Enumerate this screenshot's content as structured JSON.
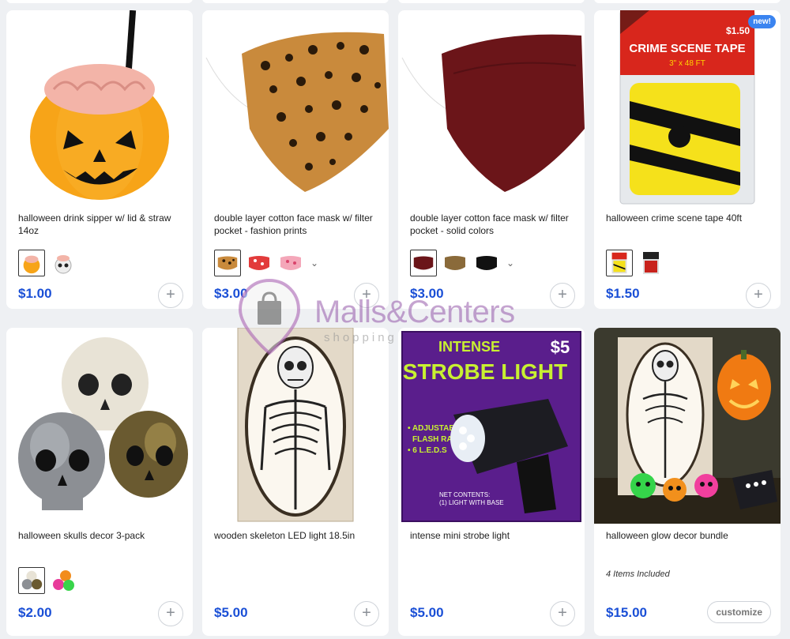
{
  "products": [
    {
      "name": "halloween drink sipper w/ lid & straw 14oz",
      "price": "$1.00",
      "image_icon": "pumpkin-sipper-icon",
      "swatches": [
        "pumpkin-sipper-swatch",
        "skull-sipper-swatch"
      ],
      "more_swatches": false,
      "action": "add"
    },
    {
      "name": "double layer cotton face mask w/ filter pocket - fashion prints",
      "price": "$3.00",
      "image_icon": "leopard-mask-icon",
      "swatches": [
        "leopard-swatch",
        "red-print-swatch",
        "pink-print-swatch"
      ],
      "more_swatches": true,
      "action": "add"
    },
    {
      "name": "double layer cotton face mask w/ filter pocket - solid colors",
      "price": "$3.00",
      "image_icon": "maroon-mask-icon",
      "swatches": [
        "maroon-swatch",
        "tan-swatch",
        "black-swatch"
      ],
      "more_swatches": true,
      "action": "add"
    },
    {
      "name": "halloween crime scene tape 40ft",
      "price": "$1.50",
      "badge": "new!",
      "image_icon": "crime-scene-tape-icon",
      "swatches": [
        "yellow-tape-swatch",
        "red-tape-swatch"
      ],
      "more_swatches": false,
      "action": "add"
    },
    {
      "name": "halloween skulls decor 3-pack",
      "price": "$2.00",
      "image_icon": "skulls-icon",
      "swatches": [
        "metal-skulls-swatch",
        "neon-skulls-swatch"
      ],
      "more_swatches": false,
      "action": "add"
    },
    {
      "name": "wooden skeleton LED light 18.5in",
      "price": "$5.00",
      "image_icon": "skeleton-frame-icon",
      "swatches": [],
      "more_swatches": false,
      "action": "add"
    },
    {
      "name": "intense mini strobe light",
      "price": "$5.00",
      "image_icon": "strobe-light-icon",
      "swatches": [],
      "more_swatches": false,
      "action": "add"
    },
    {
      "name": "halloween glow decor bundle",
      "price": "$15.00",
      "included": "4 Items Included",
      "image_icon": "glow-bundle-icon",
      "swatches": [],
      "more_swatches": false,
      "action": "customize",
      "action_label": "customize"
    }
  ],
  "package_text": {
    "tape_title": "CRIME SCENE TAPE",
    "tape_size": "3\" x 48 FT",
    "tape_price": "$1.50",
    "strobe_line1": "INTENSE",
    "strobe_line2": "STROBE LIGHT",
    "strobe_price": "$5",
    "strobe_feature1": "• ADJUSTABLE",
    "strobe_feature2": "FLASH RATE",
    "strobe_feature3": "• 6 L.E.D.S",
    "strobe_contents": "NET CONTENTS:",
    "strobe_contents2": "(1) LIGHT WITH BASE"
  },
  "watermark": {
    "brand": "Malls&Centers",
    "sub": "shopping"
  },
  "colors": {
    "price": "#1a4fd6",
    "badge": "#3a84f0",
    "page_bg": "#eef0f3"
  }
}
